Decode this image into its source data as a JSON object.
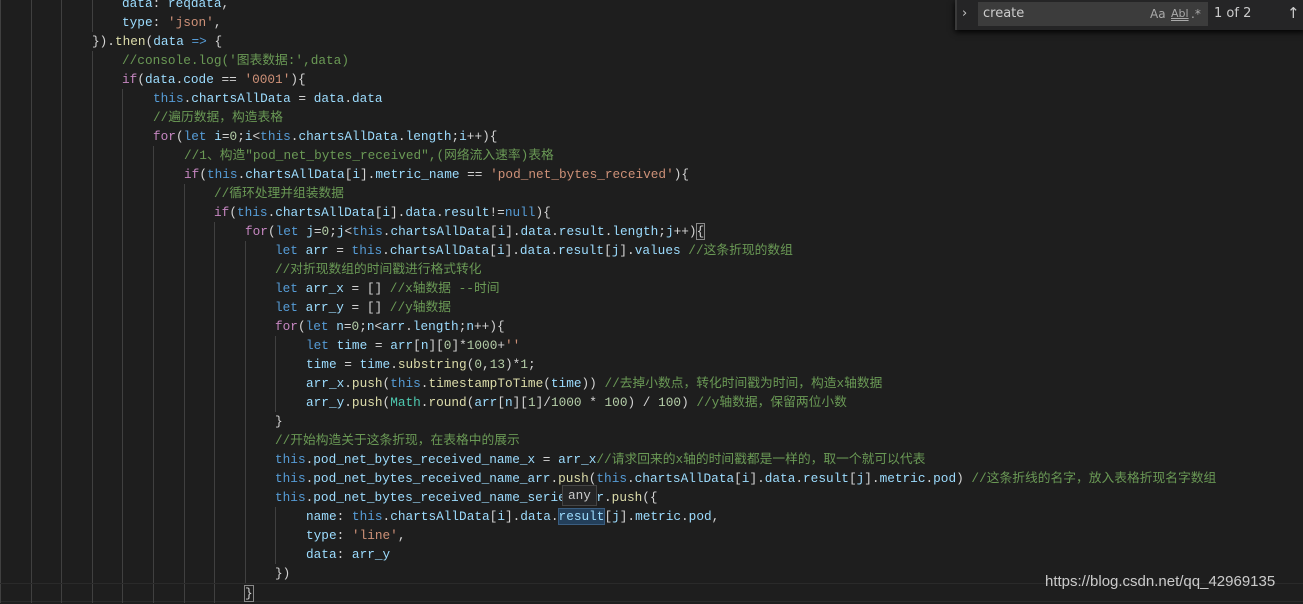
{
  "find_widget": {
    "query": "create",
    "match_case_label": "Aa",
    "whole_word_label": "Abl",
    "regex_label": ".*",
    "result_count": "1 of 2",
    "toggle_icon": "chevron-right-icon",
    "prev_icon": "arrow-up-icon"
  },
  "hover_tooltip": "any",
  "watermark": "https://blog.csdn.net/qq_42969135",
  "colors": {
    "background": "#1e1e1e",
    "keyword": "#569cd6",
    "control": "#c586c0",
    "variable": "#9cdcfe",
    "function": "#dcdcaa",
    "string": "#ce9178",
    "comment": "#6a9955",
    "number": "#b5cea8"
  },
  "lines": [
    {
      "indent": 4,
      "tokens": [
        [
          "v",
          "data"
        ],
        [
          "p",
          ": "
        ],
        [
          "v",
          "reqdata"
        ],
        [
          "p",
          ","
        ]
      ]
    },
    {
      "indent": 4,
      "tokens": [
        [
          "v",
          "type"
        ],
        [
          "p",
          ": "
        ],
        [
          "s",
          "'json'"
        ],
        [
          "p",
          ","
        ]
      ]
    },
    {
      "indent": 3,
      "tokens": [
        [
          "p",
          "})."
        ],
        [
          "f",
          "then"
        ],
        [
          "p",
          "("
        ],
        [
          "v",
          "data"
        ],
        [
          "k",
          " =>"
        ],
        [
          "p",
          " {"
        ]
      ]
    },
    {
      "indent": 4,
      "tokens": [
        [
          "m",
          "//console.log('图表数据:',data)"
        ]
      ]
    },
    {
      "indent": 4,
      "tokens": [
        [
          "c",
          "if"
        ],
        [
          "p",
          "("
        ],
        [
          "v",
          "data"
        ],
        [
          "p",
          "."
        ],
        [
          "v",
          "code"
        ],
        [
          "p",
          " == "
        ],
        [
          "s",
          "'0001'"
        ],
        [
          "p",
          "){"
        ]
      ]
    },
    {
      "indent": 5,
      "tokens": [
        [
          "k",
          "this"
        ],
        [
          "p",
          "."
        ],
        [
          "v",
          "chartsAllData"
        ],
        [
          "p",
          " = "
        ],
        [
          "v",
          "data"
        ],
        [
          "p",
          "."
        ],
        [
          "v",
          "data"
        ]
      ]
    },
    {
      "indent": 5,
      "tokens": [
        [
          "m",
          "//遍历数据，构造表格"
        ]
      ]
    },
    {
      "indent": 5,
      "tokens": [
        [
          "c",
          "for"
        ],
        [
          "p",
          "("
        ],
        [
          "k",
          "let "
        ],
        [
          "v",
          "i"
        ],
        [
          "p",
          "="
        ],
        [
          "n",
          "0"
        ],
        [
          "p",
          ";"
        ],
        [
          "v",
          "i"
        ],
        [
          "p",
          "<"
        ],
        [
          "k",
          "this"
        ],
        [
          "p",
          "."
        ],
        [
          "v",
          "chartsAllData"
        ],
        [
          "p",
          "."
        ],
        [
          "v",
          "length"
        ],
        [
          "p",
          ";"
        ],
        [
          "v",
          "i"
        ],
        [
          "p",
          "++){"
        ]
      ]
    },
    {
      "indent": 6,
      "tokens": [
        [
          "m",
          "//1、构造\"pod_net_bytes_received\",(网络流入速率)表格"
        ]
      ]
    },
    {
      "indent": 6,
      "tokens": [
        [
          "c",
          "if"
        ],
        [
          "p",
          "("
        ],
        [
          "k",
          "this"
        ],
        [
          "p",
          "."
        ],
        [
          "v",
          "chartsAllData"
        ],
        [
          "p",
          "["
        ],
        [
          "v",
          "i"
        ],
        [
          "p",
          "]."
        ],
        [
          "v",
          "metric_name"
        ],
        [
          "p",
          " == "
        ],
        [
          "s",
          "'pod_net_bytes_received'"
        ],
        [
          "p",
          "){"
        ]
      ]
    },
    {
      "indent": 7,
      "tokens": [
        [
          "m",
          "//循环处理并组装数据"
        ]
      ]
    },
    {
      "indent": 7,
      "tokens": [
        [
          "c",
          "if"
        ],
        [
          "p",
          "("
        ],
        [
          "k",
          "this"
        ],
        [
          "p",
          "."
        ],
        [
          "v",
          "chartsAllData"
        ],
        [
          "p",
          "["
        ],
        [
          "v",
          "i"
        ],
        [
          "p",
          "]."
        ],
        [
          "v",
          "data"
        ],
        [
          "p",
          "."
        ],
        [
          "v",
          "result"
        ],
        [
          "p",
          "!="
        ],
        [
          "k",
          "null"
        ],
        [
          "p",
          ")"
        ],
        [
          "p",
          "{"
        ]
      ]
    },
    {
      "indent": 8,
      "tokens": [
        [
          "c",
          "for"
        ],
        [
          "p",
          "("
        ],
        [
          "k",
          "let "
        ],
        [
          "v",
          "j"
        ],
        [
          "p",
          "="
        ],
        [
          "n",
          "0"
        ],
        [
          "p",
          ";"
        ],
        [
          "v",
          "j"
        ],
        [
          "p",
          "<"
        ],
        [
          "k",
          "this"
        ],
        [
          "p",
          "."
        ],
        [
          "v",
          "chartsAllData"
        ],
        [
          "p",
          "["
        ],
        [
          "v",
          "i"
        ],
        [
          "p",
          "]."
        ],
        [
          "v",
          "data"
        ],
        [
          "p",
          "."
        ],
        [
          "v",
          "result"
        ],
        [
          "p",
          "."
        ],
        [
          "v",
          "length"
        ],
        [
          "p",
          ";"
        ],
        [
          "v",
          "j"
        ],
        [
          "p",
          "++)"
        ],
        [
          "br",
          "{"
        ]
      ]
    },
    {
      "indent": 9,
      "tokens": [
        [
          "k",
          "let "
        ],
        [
          "v",
          "arr"
        ],
        [
          "p",
          " = "
        ],
        [
          "k",
          "this"
        ],
        [
          "p",
          "."
        ],
        [
          "v",
          "chartsAllData"
        ],
        [
          "p",
          "["
        ],
        [
          "v",
          "i"
        ],
        [
          "p",
          "]."
        ],
        [
          "v",
          "data"
        ],
        [
          "p",
          "."
        ],
        [
          "v",
          "result"
        ],
        [
          "p",
          "["
        ],
        [
          "v",
          "j"
        ],
        [
          "p",
          "]."
        ],
        [
          "v",
          "values"
        ],
        [
          "m",
          " //这条折现的数组"
        ]
      ]
    },
    {
      "indent": 9,
      "tokens": [
        [
          "m",
          "//对折现数组的时间戳进行格式转化"
        ]
      ]
    },
    {
      "indent": 9,
      "tokens": [
        [
          "k",
          "let "
        ],
        [
          "v",
          "arr_x"
        ],
        [
          "p",
          " = [] "
        ],
        [
          "m",
          "//x轴数据 --时间"
        ]
      ]
    },
    {
      "indent": 9,
      "tokens": [
        [
          "k",
          "let "
        ],
        [
          "v",
          "arr_y"
        ],
        [
          "p",
          " = [] "
        ],
        [
          "m",
          "//y轴数据"
        ]
      ]
    },
    {
      "indent": 9,
      "tokens": [
        [
          "c",
          "for"
        ],
        [
          "p",
          "("
        ],
        [
          "k",
          "let "
        ],
        [
          "v",
          "n"
        ],
        [
          "p",
          "="
        ],
        [
          "n",
          "0"
        ],
        [
          "p",
          ";"
        ],
        [
          "v",
          "n"
        ],
        [
          "p",
          "<"
        ],
        [
          "v",
          "arr"
        ],
        [
          "p",
          "."
        ],
        [
          "v",
          "length"
        ],
        [
          "p",
          ";"
        ],
        [
          "v",
          "n"
        ],
        [
          "p",
          "++){"
        ]
      ]
    },
    {
      "indent": 10,
      "tokens": [
        [
          "k",
          "let "
        ],
        [
          "v",
          "time"
        ],
        [
          "p",
          " = "
        ],
        [
          "v",
          "arr"
        ],
        [
          "p",
          "["
        ],
        [
          "v",
          "n"
        ],
        [
          "p",
          "]["
        ],
        [
          "n",
          "0"
        ],
        [
          "p",
          "]*"
        ],
        [
          "n",
          "1000"
        ],
        [
          "p",
          "+"
        ],
        [
          "s",
          "''"
        ]
      ]
    },
    {
      "indent": 10,
      "tokens": [
        [
          "v",
          "time"
        ],
        [
          "p",
          " = "
        ],
        [
          "v",
          "time"
        ],
        [
          "p",
          "."
        ],
        [
          "f",
          "substring"
        ],
        [
          "p",
          "("
        ],
        [
          "n",
          "0"
        ],
        [
          "p",
          ","
        ],
        [
          "n",
          "13"
        ],
        [
          "p",
          ")*"
        ],
        [
          "n",
          "1"
        ],
        [
          "p",
          ";"
        ]
      ]
    },
    {
      "indent": 10,
      "tokens": [
        [
          "v",
          "arr_x"
        ],
        [
          "p",
          "."
        ],
        [
          "f",
          "push"
        ],
        [
          "p",
          "("
        ],
        [
          "k",
          "this"
        ],
        [
          "p",
          "."
        ],
        [
          "f",
          "timestampToTime"
        ],
        [
          "p",
          "("
        ],
        [
          "v",
          "time"
        ],
        [
          "p",
          "))"
        ],
        [
          "m",
          " //去掉小数点，转化时间戳为时间，构造x轴数据"
        ]
      ]
    },
    {
      "indent": 10,
      "tokens": [
        [
          "v",
          "arr_y"
        ],
        [
          "p",
          "."
        ],
        [
          "f",
          "push"
        ],
        [
          "p",
          "("
        ],
        [
          "t",
          "Math"
        ],
        [
          "p",
          "."
        ],
        [
          "f",
          "round"
        ],
        [
          "p",
          "("
        ],
        [
          "v",
          "arr"
        ],
        [
          "p",
          "["
        ],
        [
          "v",
          "n"
        ],
        [
          "p",
          "]["
        ],
        [
          "n",
          "1"
        ],
        [
          "p",
          "]/"
        ],
        [
          "n",
          "1000"
        ],
        [
          "p",
          " * "
        ],
        [
          "n",
          "100"
        ],
        [
          "p",
          ") / "
        ],
        [
          "n",
          "100"
        ],
        [
          "p",
          ")"
        ],
        [
          "m",
          " //y轴数据，保留两位小数"
        ]
      ]
    },
    {
      "indent": 9,
      "tokens": [
        [
          "p",
          "}"
        ]
      ]
    },
    {
      "indent": 9,
      "tokens": [
        [
          "m",
          "//开始构造关于这条折现，在表格中的展示"
        ]
      ]
    },
    {
      "indent": 9,
      "tokens": [
        [
          "k",
          "this"
        ],
        [
          "p",
          "."
        ],
        [
          "v",
          "pod_net_bytes_received_name_x"
        ],
        [
          "p",
          " = "
        ],
        [
          "v",
          "arr_x"
        ],
        [
          "m",
          "//请求回来的x轴的时间戳都是一样的，取一个就可以代表"
        ]
      ]
    },
    {
      "indent": 9,
      "tokens": [
        [
          "k",
          "this"
        ],
        [
          "p",
          "."
        ],
        [
          "v",
          "pod_net_bytes_received_name_arr"
        ],
        [
          "p",
          "."
        ],
        [
          "f",
          "push"
        ],
        [
          "p",
          "("
        ],
        [
          "k",
          "this"
        ],
        [
          "p",
          "."
        ],
        [
          "v",
          "chartsAllData"
        ],
        [
          "p",
          "["
        ],
        [
          "v",
          "i"
        ],
        [
          "p",
          "]."
        ],
        [
          "v",
          "data"
        ],
        [
          "p",
          "."
        ],
        [
          "v",
          "result"
        ],
        [
          "p",
          "["
        ],
        [
          "v",
          "j"
        ],
        [
          "p",
          "]."
        ],
        [
          "v",
          "metric"
        ],
        [
          "p",
          "."
        ],
        [
          "v",
          "pod"
        ],
        [
          "p",
          ")"
        ],
        [
          "m",
          " //这条折线的名字，放入表格折现名字数组"
        ]
      ]
    },
    {
      "indent": 9,
      "tokens": [
        [
          "k",
          "this"
        ],
        [
          "p",
          "."
        ],
        [
          "v",
          "pod_net_bytes_received_name_series_arr"
        ],
        [
          "p",
          "."
        ],
        [
          "f",
          "push"
        ],
        [
          "p",
          "({"
        ]
      ]
    },
    {
      "indent": 10,
      "tokens": [
        [
          "v",
          "name"
        ],
        [
          "p",
          ": "
        ],
        [
          "k",
          "this"
        ],
        [
          "p",
          "."
        ],
        [
          "v",
          "chartsAllData"
        ],
        [
          "p",
          "["
        ],
        [
          "v",
          "i"
        ],
        [
          "p",
          "]."
        ],
        [
          "v",
          "data"
        ],
        [
          "p",
          "."
        ],
        [
          "hl",
          "result"
        ],
        [
          "p",
          "["
        ],
        [
          "v",
          "j"
        ],
        [
          "p",
          "]."
        ],
        [
          "v",
          "metric"
        ],
        [
          "p",
          "."
        ],
        [
          "v",
          "pod"
        ],
        [
          "p",
          ","
        ]
      ]
    },
    {
      "indent": 10,
      "tokens": [
        [
          "v",
          "type"
        ],
        [
          "p",
          ": "
        ],
        [
          "s",
          "'line'"
        ],
        [
          "p",
          ","
        ]
      ]
    },
    {
      "indent": 10,
      "tokens": [
        [
          "v",
          "data"
        ],
        [
          "p",
          ": "
        ],
        [
          "v",
          "arr_y"
        ]
      ]
    },
    {
      "indent": 9,
      "tokens": [
        [
          "p",
          "})"
        ]
      ]
    },
    {
      "indent": 8,
      "tokens": [
        [
          "br",
          "}"
        ]
      ]
    }
  ]
}
